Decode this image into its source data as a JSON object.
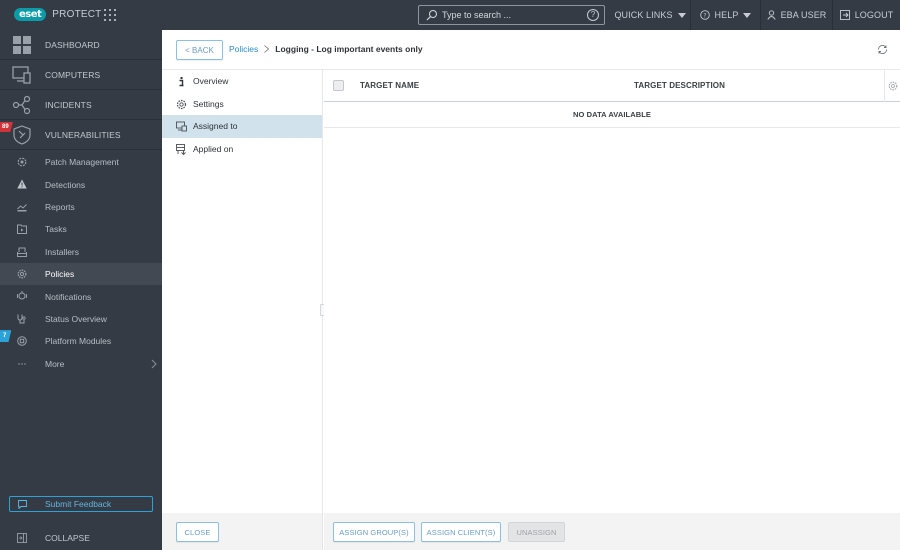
{
  "topbar": {
    "logo_badge": "eset",
    "product_name": "PROTECT",
    "search": {
      "placeholder": "Type to search ...",
      "value": ""
    },
    "help_tooltip_icon": "question-circle-icon",
    "quick_links": "QUICK LINKS",
    "help": "HELP",
    "user": "EBA USER",
    "logout": "LOGOUT"
  },
  "sidebar": {
    "main_items": [
      {
        "label": "DASHBOARD",
        "icon": "dashboard-icon"
      },
      {
        "label": "COMPUTERS",
        "icon": "computers-icon"
      },
      {
        "label": "INCIDENTS",
        "icon": "incidents-icon"
      },
      {
        "label": "VULNERABILITIES",
        "icon": "vulnerabilities-icon",
        "badge": "89"
      }
    ],
    "sub_items": [
      {
        "label": "Patch Management",
        "icon": "patch-icon"
      },
      {
        "label": "Detections",
        "icon": "warning-icon"
      },
      {
        "label": "Reports",
        "icon": "reports-icon"
      },
      {
        "label": "Tasks",
        "icon": "tasks-icon"
      },
      {
        "label": "Installers",
        "icon": "installers-icon"
      },
      {
        "label": "Policies",
        "icon": "policies-icon",
        "active": true
      },
      {
        "label": "Notifications",
        "icon": "notifications-icon"
      },
      {
        "label": "Status Overview",
        "icon": "status-icon"
      },
      {
        "label": "Platform Modules",
        "icon": "modules-icon",
        "badge": "7"
      },
      {
        "label": "More",
        "icon": "more-icon"
      }
    ],
    "submit_feedback": "Submit Feedback",
    "collapse": "COLLAPSE"
  },
  "header": {
    "back_label": "< BACK",
    "breadcrumb_link": "Policies",
    "breadcrumb_current": "Logging - Log important events only"
  },
  "detail_nav": {
    "items": [
      {
        "label": "Overview",
        "icon": "info-icon"
      },
      {
        "label": "Settings",
        "icon": "gear-icon"
      },
      {
        "label": "Assigned to",
        "icon": "assigned-icon",
        "active": true
      },
      {
        "label": "Applied on",
        "icon": "applied-icon"
      }
    ]
  },
  "table": {
    "columns": [
      "TARGET NAME",
      "TARGET DESCRIPTION"
    ],
    "rows": [],
    "empty_message": "NO DATA AVAILABLE"
  },
  "footer": {
    "close": "CLOSE",
    "assign_groups": "ASSIGN GROUP(S)",
    "assign_clients": "ASSIGN CLIENT(S)",
    "unassign": "UNASSIGN"
  },
  "colors": {
    "brand": "#0a9ca8",
    "sidebar_bg": "#353b44",
    "link": "#2b8ac4",
    "active_row": "#d1e2ec",
    "badge_red": "#d0343b",
    "badge_blue": "#2ba2d8"
  }
}
